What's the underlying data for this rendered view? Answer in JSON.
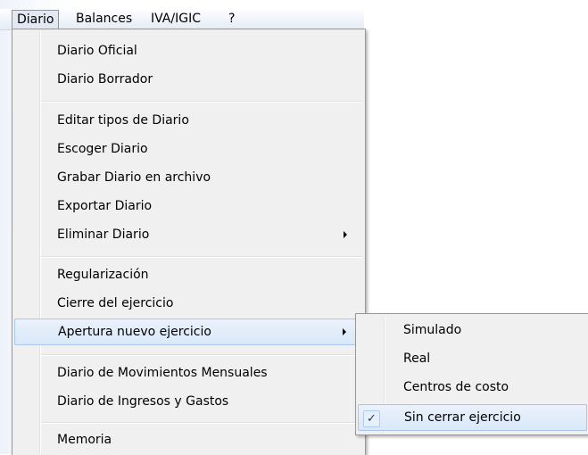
{
  "menubar": {
    "items": [
      "Diario",
      "Balances",
      "IVA/IGIC",
      "?"
    ]
  },
  "diario_menu": {
    "items": [
      {
        "label": "Diario Oficial"
      },
      {
        "label": "Diario Borrador"
      },
      {
        "label": "Editar tipos de Diario"
      },
      {
        "label": "Escoger Diario"
      },
      {
        "label": "Grabar Diario en archivo"
      },
      {
        "label": "Exportar Diario"
      },
      {
        "label": "Eliminar Diario",
        "submenu": true
      },
      {
        "label": "Regularización"
      },
      {
        "label": "Cierre del ejercicio"
      },
      {
        "label": "Apertura nuevo ejercicio",
        "submenu": true,
        "highlighted": true
      },
      {
        "label": "Diario de Movimientos Mensuales"
      },
      {
        "label": "Diario de Ingresos y Gastos"
      },
      {
        "label": "Memoria"
      }
    ]
  },
  "apertura_submenu": {
    "items": [
      {
        "label": "Simulado"
      },
      {
        "label": "Real"
      },
      {
        "label": "Centros de costo"
      },
      {
        "label": "Sin cerrar ejercicio",
        "checked": true,
        "highlighted": true
      }
    ],
    "check_glyph": "✓"
  },
  "colors": {
    "menu_bg": "#f0f0f0",
    "highlight": "#d9e8f9",
    "highlight_border": "#a9c7ea",
    "menubar_open": "#e3e8f2"
  },
  "icons": {
    "submenu_arrow": "chevron-right-icon",
    "checked_mark": "checkmark-icon"
  }
}
